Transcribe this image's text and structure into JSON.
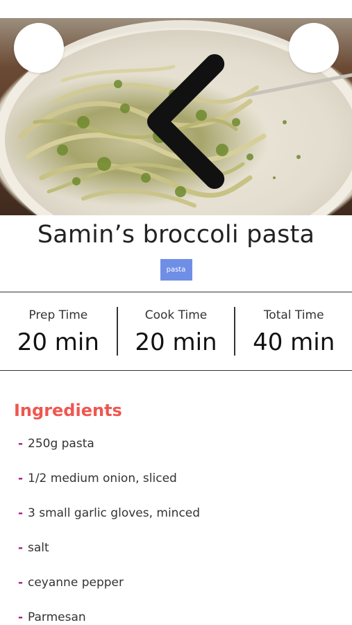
{
  "recipe": {
    "title": "Samin’s broccoli pasta",
    "tag": "pasta"
  },
  "header": {
    "back_icon": "chevron-left-icon",
    "menu_icon": "hamburger-menu-icon"
  },
  "times": [
    {
      "label": "Prep Time",
      "value": "20 min"
    },
    {
      "label": "Cook Time",
      "value": "20 min"
    },
    {
      "label": "Total Time",
      "value": "40 min"
    }
  ],
  "ingredients": {
    "title": "Ingredients",
    "items": [
      "250g pasta",
      "1/2 medium onion, sliced",
      "3 small garlic gloves, minced",
      "salt",
      "ceyanne pepper",
      "Parmesan"
    ]
  },
  "colors": {
    "accent_title": "#f0564f",
    "tag_bg": "#6f8ee6",
    "bullet": "#a61e8c"
  }
}
